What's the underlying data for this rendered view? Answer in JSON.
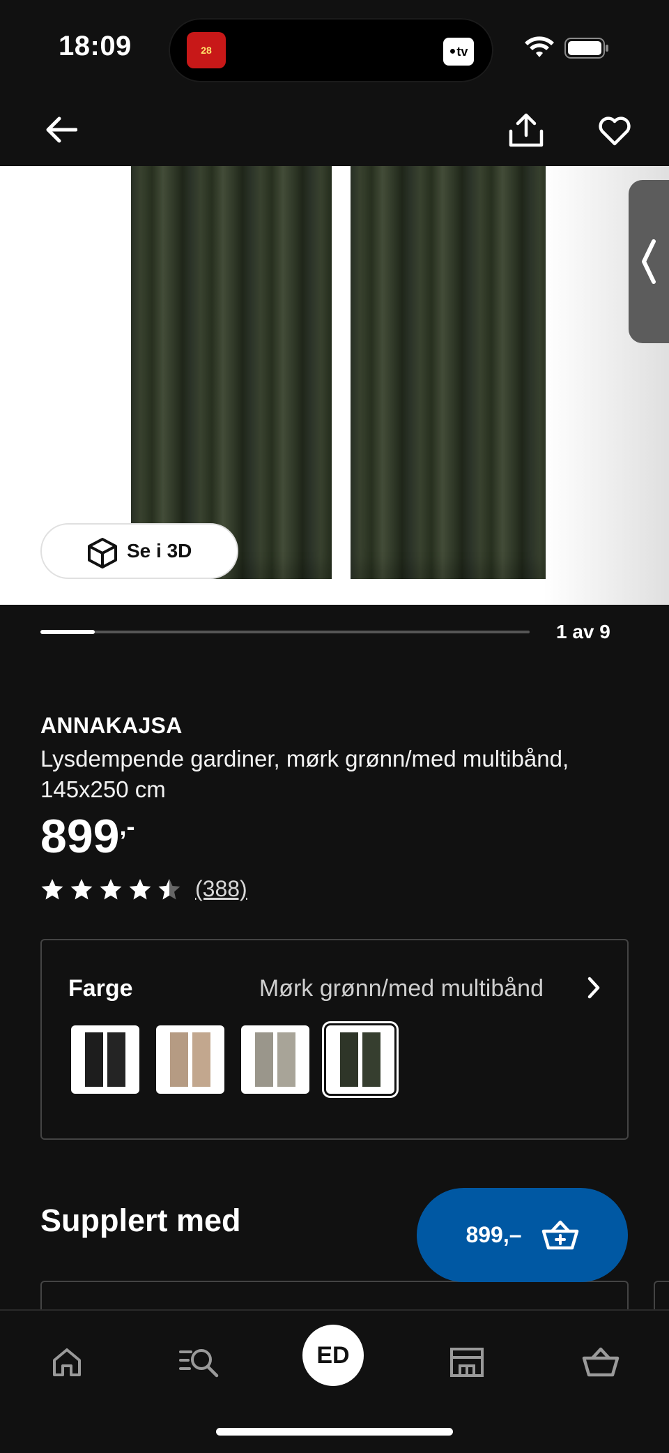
{
  "status_bar": {
    "time": "18:09",
    "island_app_label": "28",
    "island_tv_label": "tv"
  },
  "product_images": {
    "see_3d_label": "Se i 3D",
    "counter": "1 av 9",
    "progress_fraction": 0.111
  },
  "product": {
    "name": "ANNAKAJSA",
    "description": "Lysdempende gardiner, mørk grønn/med multibånd, 145x250 cm",
    "price": "899",
    "price_suffix": ",-",
    "rating": 4.5,
    "review_count": "(388)"
  },
  "color_selector": {
    "label": "Farge",
    "value": "Mørk grønn/med multibånd",
    "swatches": [
      {
        "name": "black",
        "color": "#1d1d1d"
      },
      {
        "name": "beige",
        "color": "#b59b83"
      },
      {
        "name": "grey-beige",
        "color": "#9a968b"
      },
      {
        "name": "dark-green",
        "color": "#2e3528",
        "selected": true
      }
    ]
  },
  "supplement": {
    "title": "Supplert med"
  },
  "cart_fab": {
    "price": "899,–"
  },
  "bottom_nav": {
    "items": [
      "home-icon",
      "search-icon",
      "profile",
      "store-icon",
      "basket-icon"
    ],
    "profile_initials": "ED"
  },
  "colors": {
    "accent_blue": "#0058a3",
    "background": "#111111"
  }
}
